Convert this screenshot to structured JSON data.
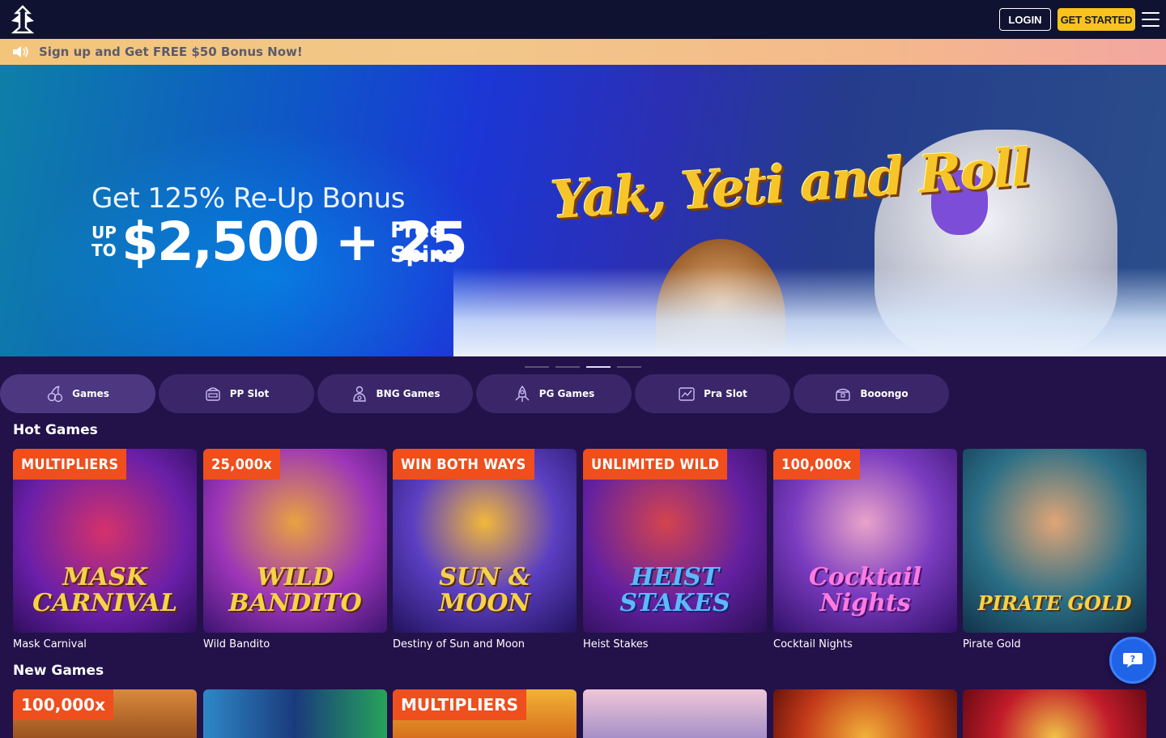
{
  "header": {
    "logo_alt": "site-logo",
    "login_label": "LOGIN",
    "get_started_label": "GET STARTED"
  },
  "notice": {
    "text": "Sign up and Get FREE $50 Bonus Now!"
  },
  "banner": {
    "line1": "Get 125% Re-Up Bonus",
    "up": "UP",
    "to": "TO",
    "amount": "$2,500 + 25",
    "free": "Free",
    "spins": "Spins",
    "game_title": "Yak, Yeti and Roll",
    "slide_count": 4,
    "active_slide": 3
  },
  "tabs": [
    {
      "label": "Games",
      "icon": "cherries-icon",
      "active": true
    },
    {
      "label": "PP Slot",
      "icon": "slot-machine-icon",
      "active": false
    },
    {
      "label": "BNG Games",
      "icon": "player-icon",
      "active": false
    },
    {
      "label": "PG Games",
      "icon": "rocket-icon",
      "active": false
    },
    {
      "label": "Pra Slot",
      "icon": "chart-icon",
      "active": false
    },
    {
      "label": "Booongo",
      "icon": "treasure-icon",
      "active": false
    }
  ],
  "hot_games": {
    "title": "Hot Games",
    "items": [
      {
        "name": "Mask Carnival",
        "badge": "MULTIPLIERS",
        "art_title": "MASK CARNIVAL",
        "bg": "#6a1fa8"
      },
      {
        "name": "Wild Bandito",
        "badge": "25,000x",
        "art_title": "WILD BANDITO",
        "bg": "#7b2fb8"
      },
      {
        "name": "Destiny of Sun and Moon",
        "badge": "WIN BOTH WAYS",
        "art_title": "SUN & MOON",
        "bg": "#3c2a9a"
      },
      {
        "name": "Heist Stakes",
        "badge": "UNLIMITED WILD",
        "art_title": "HEIST STAKES",
        "bg": "#6320a0"
      },
      {
        "name": "Cocktail Nights",
        "badge": "100,000x",
        "art_title": "Cocktail Nights",
        "bg": "#5b2aa6"
      },
      {
        "name": "Pirate Gold",
        "badge": "",
        "art_title": "PIRATE GOLD",
        "bg": "#2b6f86"
      }
    ]
  },
  "new_games": {
    "title": "New Games",
    "items": [
      {
        "badge": "100,000x",
        "bg": "#c9782e"
      },
      {
        "badge": "",
        "bg": "#2b7fb4"
      },
      {
        "badge": "MULTIPLIERS",
        "bg": "#e8a12a"
      },
      {
        "badge": "",
        "bg": "#e6b8c9"
      },
      {
        "badge": "",
        "bg": "#c43a1a"
      },
      {
        "badge": "",
        "bg": "#c21c2a"
      }
    ]
  },
  "chat": {
    "icon": "chat-bubble-icon"
  }
}
